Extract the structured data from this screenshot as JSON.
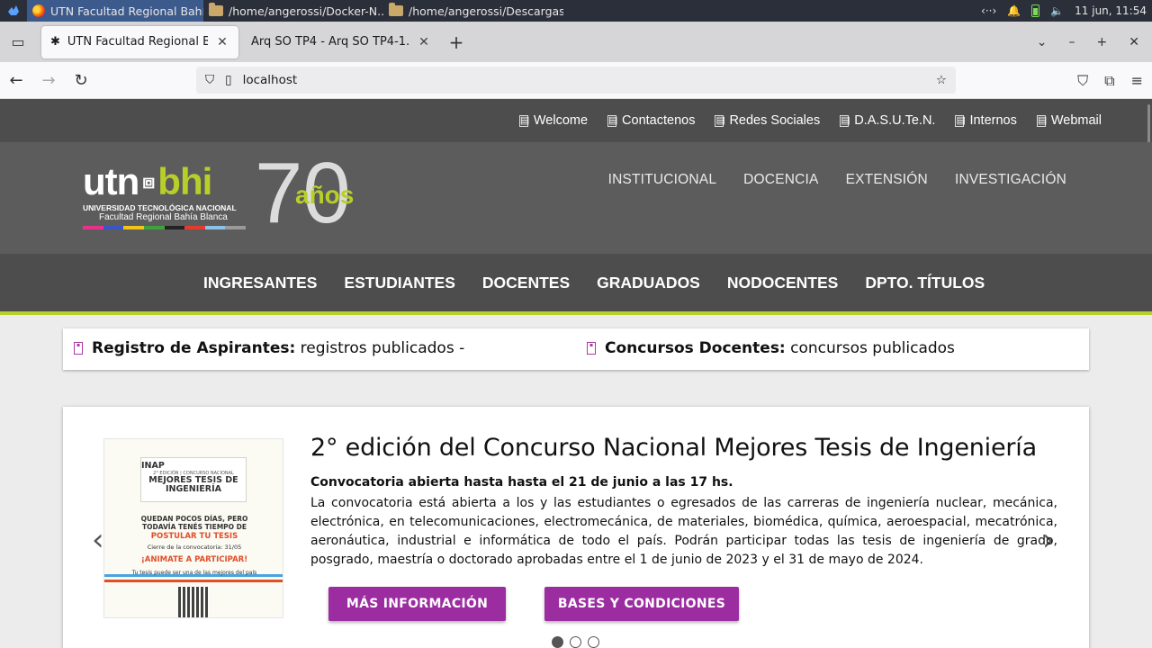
{
  "taskbar": {
    "tasks": [
      {
        "label": "UTN Facultad Regional Bahí...",
        "icon": "firefox-icon"
      },
      {
        "label": "/home/angerossi/Docker-N...",
        "icon": "folder-icon"
      },
      {
        "label": "/home/angerossi/Descargas",
        "icon": "folder-icon"
      }
    ],
    "tray": {
      "network": "‹··›",
      "clock": "11 jun, 11:54"
    }
  },
  "browser": {
    "tabs": [
      {
        "title": "UTN Facultad Regional Bahía",
        "active": true
      },
      {
        "title": "Arq SO TP4 - Arq SO TP4-1.pdf",
        "active": false
      }
    ],
    "url": "localhost"
  },
  "site": {
    "top_links": [
      "Welcome",
      "Contactenos",
      "Redes Sociales",
      "D.A.S.U.Te.N.",
      "Internos",
      "Webmail"
    ],
    "logo": {
      "utn": "utn",
      "bhi": "bhi",
      "line1": "UNIVERSIDAD TECNOLÓGICA NACIONAL",
      "line2": "Facultad Regional Bahía Blanca",
      "seventy": "70",
      "anos": "años"
    },
    "main_menu": [
      "INSTITUCIONAL",
      "DOCENCIA",
      "EXTENSIÓN",
      "INVESTIGACIÓN"
    ],
    "second_nav": [
      "INGRESANTES",
      "ESTUDIANTES",
      "DOCENTES",
      "GRADUADOS",
      "NODOCENTES",
      "DPTO. TÍTULOS"
    ],
    "ticker": [
      {
        "label": "Registro de Aspirantes:",
        "text": "registros publicados -"
      },
      {
        "label": "Concursos Docentes:",
        "text": "concursos publicados"
      }
    ],
    "slide": {
      "title": "2° edición del Concurso Nacional Mejores Tesis de Ingeniería",
      "subtitle": "Convocatoria abierta hasta hasta el 21 de junio a las 17 hs.",
      "body": "La convocatoria está abierta a los y las estudiantes o egresados de las carreras de ingeniería nuclear, mecánica, electrónica, en telecomunicaciones, electromecánica, de materiales, biomédica, química, aeroespacial, mecatrónica, aeronáutica, industrial e informática de todo el país. Podrán participar todas las tesis de ingeniería de grado, posgrado, maestría o doctorado aprobadas entre el 1 de junio de 2023 y el 31 de mayo de 2024.",
      "buttons": [
        "MÁS INFORMACIÓN",
        "BASES Y CONDICIONES"
      ],
      "poster": {
        "brand": "INAP",
        "edition": "2° EDICIÓN | CONCURSO NACIONAL",
        "heading": "MEJORES TESIS DE INGENIERÍA",
        "line1": "QUEDAN POCOS DÍAS, PERO TODAVÍA TENÉS TIEMPO DE",
        "line2": "POSTULAR TU TESIS",
        "line3": "Cierre de la convocatoria: 31/05",
        "line4": "¡ANIMATE A PARTICIPAR!",
        "line5": "Tu tesis puede ser una de las mejores del país"
      },
      "active_slide": 1,
      "total_slides": 3
    }
  },
  "colors": {
    "accent": "#b8cf2a",
    "button": "#9b2da0",
    "dark": "#4d4d4d",
    "header": "#5c5c5c"
  }
}
